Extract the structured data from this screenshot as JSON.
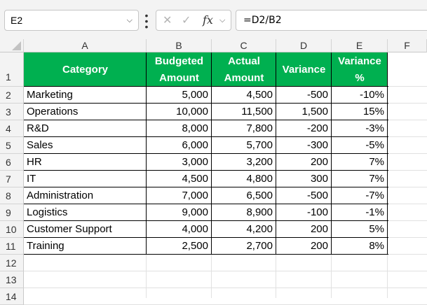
{
  "formula_bar": {
    "name_box": "E2",
    "formula": "=D2/B2",
    "fx_label": "fx",
    "cancel_glyph": "✕",
    "enter_glyph": "✓"
  },
  "columns": [
    "A",
    "B",
    "C",
    "D",
    "E",
    "F"
  ],
  "rows": [
    "1",
    "2",
    "3",
    "4",
    "5",
    "6",
    "7",
    "8",
    "9",
    "10",
    "11",
    "12",
    "13",
    "14"
  ],
  "table": {
    "header": {
      "category": "Category",
      "budgeted_1": "Budgeted",
      "budgeted_2": "Amount",
      "actual_1": "Actual",
      "actual_2": "Amount",
      "variance": "Variance",
      "variance_pct_1": "Variance",
      "variance_pct_2": "%"
    },
    "rows": [
      {
        "category": "Marketing",
        "budgeted": "5,000",
        "actual": "4,500",
        "variance": "-500",
        "variance_pct": "-10%"
      },
      {
        "category": "Operations",
        "budgeted": "10,000",
        "actual": "11,500",
        "variance": "1,500",
        "variance_pct": "15%"
      },
      {
        "category": "R&D",
        "budgeted": "8,000",
        "actual": "7,800",
        "variance": "-200",
        "variance_pct": "-3%"
      },
      {
        "category": "Sales",
        "budgeted": "6,000",
        "actual": "5,700",
        "variance": "-300",
        "variance_pct": "-5%"
      },
      {
        "category": "HR",
        "budgeted": "3,000",
        "actual": "3,200",
        "variance": "200",
        "variance_pct": "7%"
      },
      {
        "category": "IT",
        "budgeted": "4,500",
        "actual": "4,800",
        "variance": "300",
        "variance_pct": "7%"
      },
      {
        "category": "Administration",
        "budgeted": "7,000",
        "actual": "6,500",
        "variance": "-500",
        "variance_pct": "-7%"
      },
      {
        "category": "Logistics",
        "budgeted": "9,000",
        "actual": "8,900",
        "variance": "-100",
        "variance_pct": "-1%"
      },
      {
        "category": "Customer Support",
        "budgeted": "4,000",
        "actual": "4,200",
        "variance": "200",
        "variance_pct": "5%"
      },
      {
        "category": "Training",
        "budgeted": "2,500",
        "actual": "2,700",
        "variance": "200",
        "variance_pct": "8%"
      }
    ]
  },
  "colors": {
    "header_fill": "#00b050",
    "header_text": "#ffffff",
    "chrome": "#f3f3f3"
  }
}
